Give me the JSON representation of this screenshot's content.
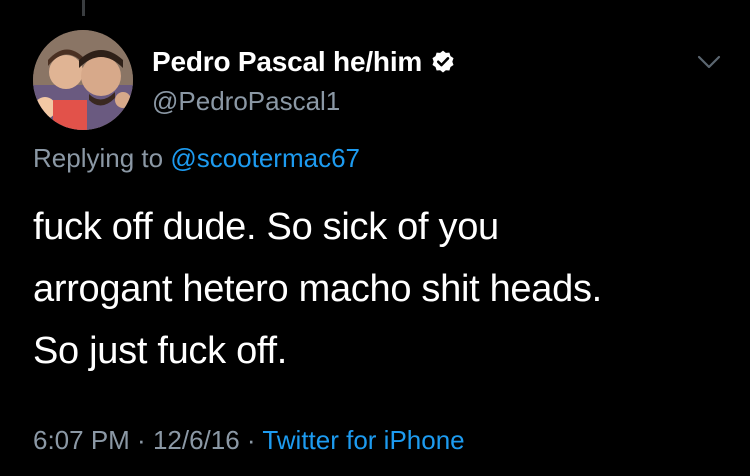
{
  "tweet": {
    "display_name": "Pedro Pascal he/him",
    "handle": "@PedroPascal1",
    "verified": true,
    "reply_prefix": "Replying to ",
    "reply_to": "@scootermac67",
    "text_lines": [
      "fuck off dude. So sick of you",
      "arrogant hetero macho shit heads.",
      "So just fuck off."
    ],
    "time": "6:07 PM",
    "separator": " · ",
    "date": "12/6/16",
    "source": "Twitter for iPhone"
  },
  "icons": {
    "verified": "verified-badge-icon",
    "menu": "chevron-down-icon"
  },
  "colors": {
    "background": "#000000",
    "primary_text": "#ffffff",
    "secondary_text": "#8b98a5",
    "link": "#1d9bf0"
  }
}
